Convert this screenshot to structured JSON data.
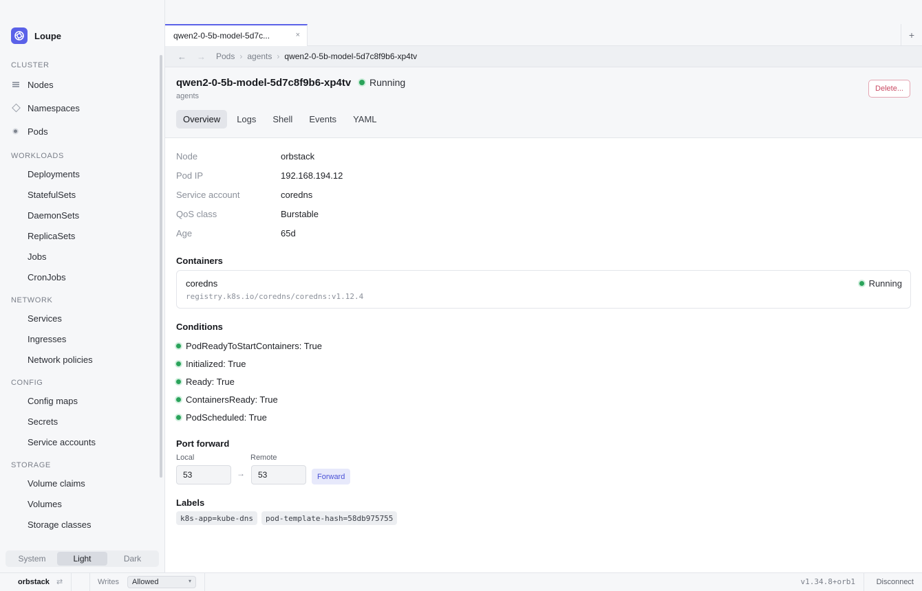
{
  "app": {
    "name": "Loupe"
  },
  "sidebar": {
    "sections": [
      {
        "title": "CLUSTER",
        "items": [
          "Nodes",
          "Namespaces",
          "Pods"
        ]
      },
      {
        "title": "WORKLOADS",
        "items": [
          "Deployments",
          "StatefulSets",
          "DaemonSets",
          "ReplicaSets",
          "Jobs",
          "CronJobs"
        ]
      },
      {
        "title": "NETWORK",
        "items": [
          "Services",
          "Ingresses",
          "Network policies"
        ]
      },
      {
        "title": "CONFIG",
        "items": [
          "Config maps",
          "Secrets",
          "Service accounts"
        ]
      },
      {
        "title": "STORAGE",
        "items": [
          "Volume claims",
          "Volumes",
          "Storage classes"
        ]
      }
    ],
    "theme": {
      "options": [
        "System",
        "Light",
        "Dark"
      ],
      "selected": "Light"
    }
  },
  "tabs": [
    {
      "label": "qwen2-0-5b-model-5d7c...",
      "close": "×"
    }
  ],
  "tab_new": "+",
  "breadcrumb": {
    "back": "←",
    "forward": "→",
    "items": [
      "Pods",
      "agents",
      "qwen2-0-5b-model-5d7c8f9b6-xp4tv"
    ]
  },
  "pod": {
    "name": "qwen2-0-5b-model-5d7c8f9b6-xp4tv",
    "status": "Running",
    "namespace": "agents",
    "delete_label": "Delete...",
    "status_color": "#2aa35a"
  },
  "subtabs": [
    "Overview",
    "Logs",
    "Shell",
    "Events",
    "YAML"
  ],
  "overview": {
    "fields": [
      {
        "key": "Node",
        "value": "orbstack"
      },
      {
        "key": "Pod IP",
        "value": "192.168.194.12"
      },
      {
        "key": "Service account",
        "value": "coredns"
      },
      {
        "key": "QoS class",
        "value": "Burstable"
      },
      {
        "key": "Age",
        "value": "65d"
      }
    ],
    "containers_title": "Containers",
    "containers": [
      {
        "name": "coredns",
        "image": "registry.k8s.io/coredns/coredns:v1.12.4",
        "status": "Running"
      }
    ],
    "conditions_title": "Conditions",
    "conditions": [
      "PodReadyToStartContainers: True",
      "Initialized: True",
      "Ready: True",
      "ContainersReady: True",
      "PodScheduled: True"
    ],
    "port_forward": {
      "title": "Port forward",
      "local_label": "Local",
      "remote_label": "Remote",
      "local_value": "53",
      "remote_value": "53",
      "arrow": "→",
      "button": "Forward"
    },
    "labels_title": "Labels",
    "labels": [
      "k8s-app=kube-dns",
      "pod-template-hash=58db975755"
    ]
  },
  "statusbar": {
    "context": "orbstack",
    "context_icon": "⇄",
    "writes_label": "Writes",
    "writes_value": "Allowed",
    "writes_caret": "▾",
    "version": "v1.34.8+orb1",
    "disconnect": "Disconnect"
  }
}
